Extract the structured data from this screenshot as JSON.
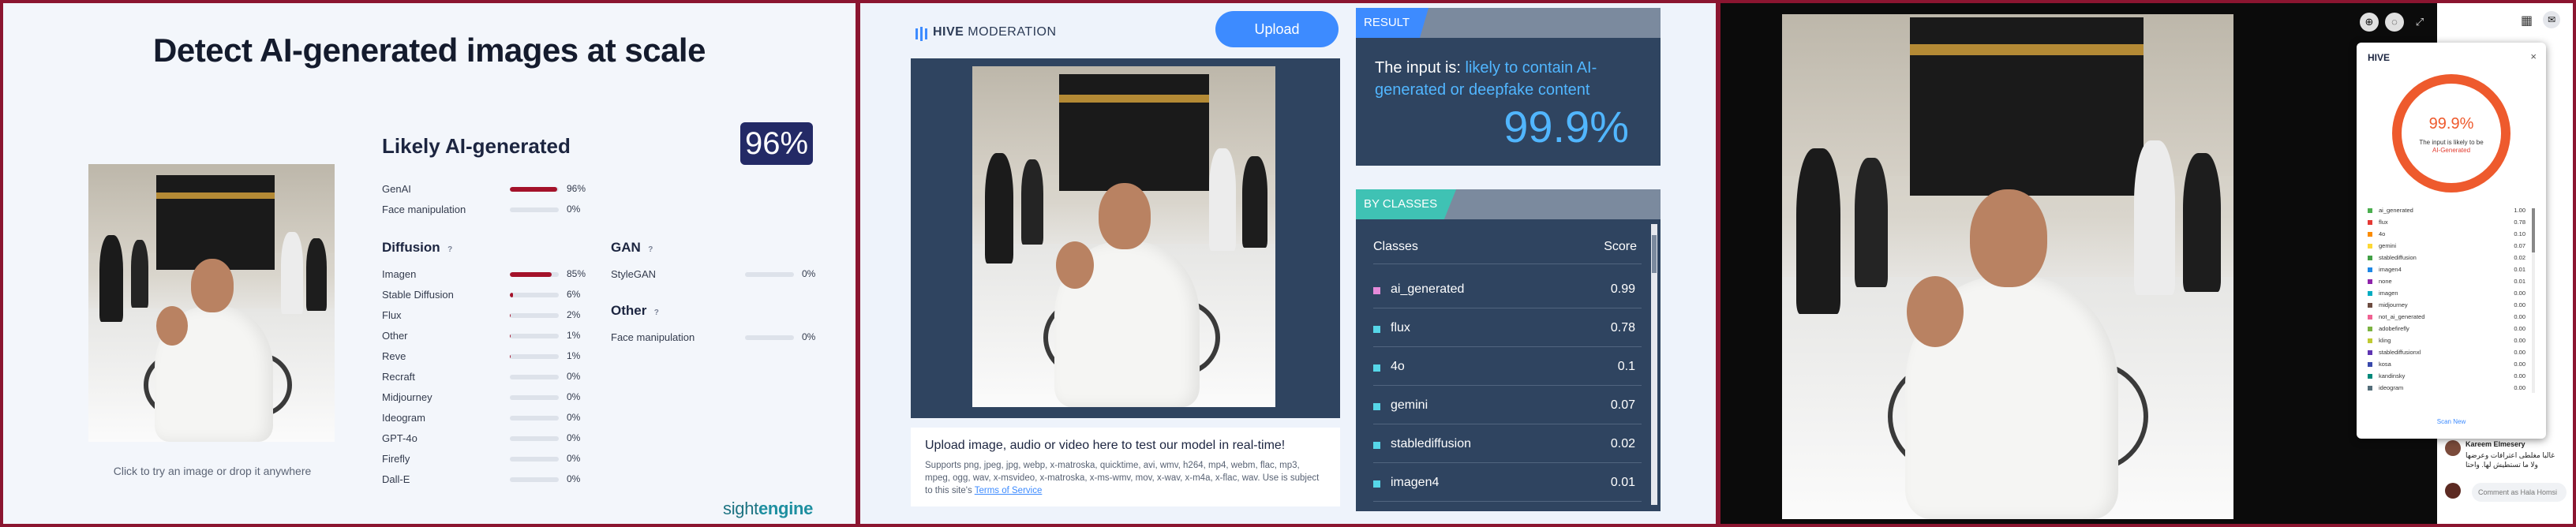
{
  "sightengine": {
    "title": "Detect AI-generated images at scale",
    "hint": "Click to try an image or drop it anywhere",
    "verdict": "Likely AI-generated",
    "score": "96%",
    "logo_a": "sight",
    "logo_b": "engine",
    "top_rows": [
      {
        "label": "GenAI",
        "value": "96%",
        "level": 96
      },
      {
        "label": "Face manipulation",
        "value": "0%",
        "level": 0
      }
    ],
    "diffusion": {
      "title": "Diffusion",
      "rows": [
        {
          "label": "Imagen",
          "value": "85%",
          "level": 85
        },
        {
          "label": "Stable Diffusion",
          "value": "6%",
          "level": 6
        },
        {
          "label": "Flux",
          "value": "2%",
          "level": 2
        },
        {
          "label": "Other",
          "value": "1%",
          "level": 1
        },
        {
          "label": "Reve",
          "value": "1%",
          "level": 1
        },
        {
          "label": "Recraft",
          "value": "0%",
          "level": 0
        },
        {
          "label": "Midjourney",
          "value": "0%",
          "level": 0
        },
        {
          "label": "Ideogram",
          "value": "0%",
          "level": 0
        },
        {
          "label": "GPT-4o",
          "value": "0%",
          "level": 0
        },
        {
          "label": "Firefly",
          "value": "0%",
          "level": 0
        },
        {
          "label": "Dall-E",
          "value": "0%",
          "level": 0
        }
      ]
    },
    "gan": {
      "title": "GAN",
      "rows": [
        {
          "label": "StyleGAN",
          "value": "0%",
          "level": 0
        }
      ]
    },
    "other": {
      "title": "Other",
      "rows": [
        {
          "label": "Face manipulation",
          "value": "0%",
          "level": 0
        }
      ]
    },
    "help_glyph": "?"
  },
  "hive": {
    "brand_a": "HIVE",
    "brand_b": "MODERATION",
    "upload_label": "Upload",
    "upload_heading": "Upload image, audio or video here to test our model in real-time!",
    "upload_text": "Supports png, jpeg, jpg, webp, x-matroska, quicktime, avi, wmv, h264, mp4, webm, flac, mp3, mpeg, ogg, wav, x-msvideo, x-matroska, x-ms-wmv, mov, x-wav, x-m4a, x-flac, wav. Use is subject to this site's",
    "terms_link": "Terms of Service",
    "result_tag": "RESULT",
    "result_prefix": "The input is:",
    "result_verdict": "likely to contain AI-generated or deepfake content",
    "result_score": "99.9%",
    "classes_tag": "BY CLASSES",
    "col_classes": "Classes",
    "col_score": "Score",
    "rows": [
      {
        "name": "ai_generated",
        "score": "0.99",
        "color": "#e58ad9"
      },
      {
        "name": "flux",
        "score": "0.78",
        "color": "#56d6e8"
      },
      {
        "name": "4o",
        "score": "0.1",
        "color": "#56d6e8"
      },
      {
        "name": "gemini",
        "score": "0.07",
        "color": "#56d6e8"
      },
      {
        "name": "stablediffusion",
        "score": "0.02",
        "color": "#56d6e8"
      },
      {
        "name": "imagen4",
        "score": "0.01",
        "color": "#56d6e8"
      }
    ]
  },
  "extension": {
    "brand": "HIVE",
    "close": "×",
    "percent": "99.9%",
    "sub1": "The input is likely to be",
    "sub2": "AI-Generated",
    "scan_new": "Scan New",
    "rows": [
      {
        "name": "ai_generated",
        "score": "1.00",
        "color": "#4caf50"
      },
      {
        "name": "flux",
        "score": "0.78",
        "color": "#e53935"
      },
      {
        "name": "4o",
        "score": "0.10",
        "color": "#fb8c00"
      },
      {
        "name": "gemini",
        "score": "0.07",
        "color": "#fdd835"
      },
      {
        "name": "stablediffusion",
        "score": "0.02",
        "color": "#43a047"
      },
      {
        "name": "imagen4",
        "score": "0.01",
        "color": "#1e88e5"
      },
      {
        "name": "none",
        "score": "0.01",
        "color": "#8e24aa"
      },
      {
        "name": "imagen",
        "score": "0.00",
        "color": "#00acc1"
      },
      {
        "name": "midjourney",
        "score": "0.00",
        "color": "#6d4c41"
      },
      {
        "name": "not_ai_generated",
        "score": "0.00",
        "color": "#f06292"
      },
      {
        "name": "adobefirefly",
        "score": "0.00",
        "color": "#7cb342"
      },
      {
        "name": "kling",
        "score": "0.00",
        "color": "#c0ca33"
      },
      {
        "name": "stablediffusionxl",
        "score": "0.00",
        "color": "#5e35b1"
      },
      {
        "name": "kosa",
        "score": "0.00",
        "color": "#3949ab"
      },
      {
        "name": "kandinsky",
        "score": "0.00",
        "color": "#00897b"
      },
      {
        "name": "ideogram",
        "score": "0.00",
        "color": "#546e7a"
      }
    ],
    "commenter": "Kareem Elmesery",
    "comment_line1": "غالبا مغلطی اعترافات وعرضها",
    "comment_line2": "ولا ما تستطیش لها. واحتا",
    "comment_placeholder": "Comment as Hala Homsi"
  }
}
